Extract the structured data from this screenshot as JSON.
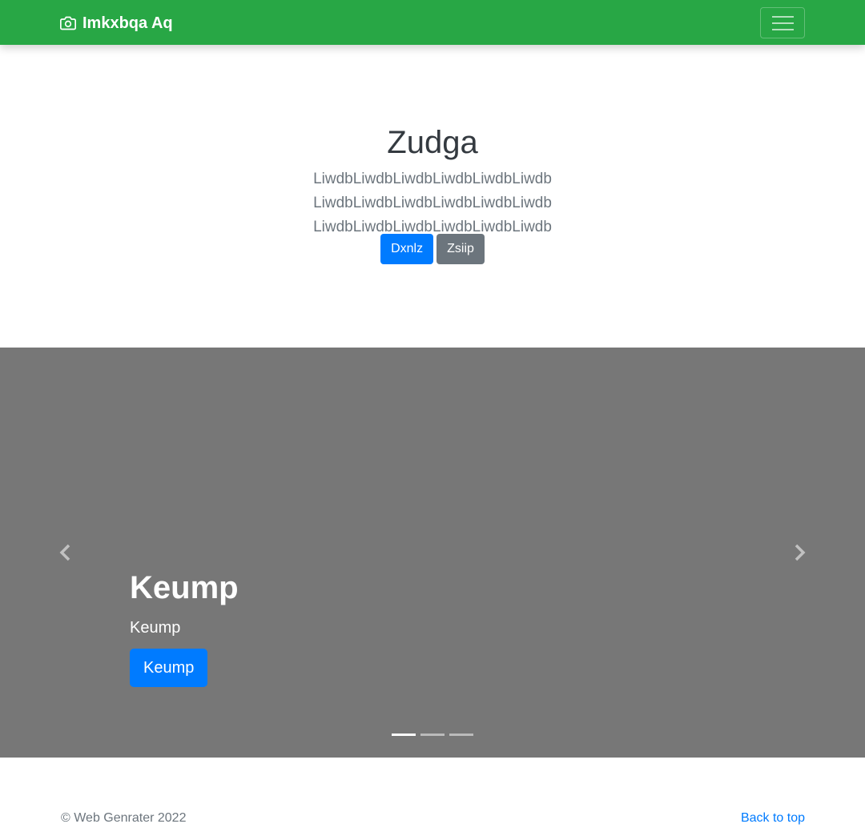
{
  "navbar": {
    "brand": "Imkxbqa Aq",
    "brand_icon": "camera-icon",
    "toggler_icon": "hamburger-menu-icon",
    "color": "#28a745"
  },
  "hero": {
    "title": "Zudga",
    "lead": "LiwdbLiwdbLiwdbLiwdbLiwdbLiwdb LiwdbLiwdbLiwdbLiwdbLiwdbLiwdb LiwdbLiwdbLiwdbLiwdbLiwdbLiwdb",
    "primary_button": "Dxnlz",
    "secondary_button": "Zsiip"
  },
  "carousel": {
    "background": "#777777",
    "caption_title": "Keump",
    "caption_text": "Keump",
    "caption_button": "Keump",
    "prev_icon": "chevron-left-icon",
    "next_icon": "chevron-right-icon",
    "slide_count": 3,
    "active_slide": 1
  },
  "footer": {
    "copyright": "© Web Genrater 2022",
    "back_to_top": "Back to top"
  },
  "colors": {
    "primary": "#007bff",
    "secondary": "#6c757d"
  }
}
